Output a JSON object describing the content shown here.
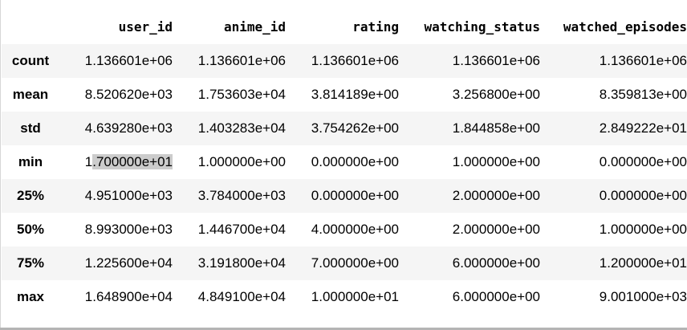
{
  "table": {
    "columns": [
      "user_id",
      "anime_id",
      "rating",
      "watching_status",
      "watched_episodes"
    ],
    "rows": [
      {
        "label": "count",
        "values": [
          "1.136601e+06",
          "1.136601e+06",
          "1.136601e+06",
          "1.136601e+06",
          "1.136601e+06"
        ]
      },
      {
        "label": "mean",
        "values": [
          "8.520620e+03",
          "1.753603e+04",
          "3.814189e+00",
          "3.256800e+00",
          "8.359813e+00"
        ]
      },
      {
        "label": "std",
        "values": [
          "4.639280e+03",
          "1.403283e+04",
          "3.754262e+00",
          "1.844858e+00",
          "2.849222e+01"
        ]
      },
      {
        "label": "min",
        "values": [
          "1.700000e+01",
          "1.000000e+00",
          "0.000000e+00",
          "1.000000e+00",
          "0.000000e+00"
        ]
      },
      {
        "label": "25%",
        "values": [
          "4.951000e+03",
          "3.784000e+03",
          "0.000000e+00",
          "2.000000e+00",
          "0.000000e+00"
        ]
      },
      {
        "label": "50%",
        "values": [
          "8.993000e+03",
          "1.446700e+04",
          "4.000000e+00",
          "2.000000e+00",
          "1.000000e+00"
        ]
      },
      {
        "label": "75%",
        "values": [
          "1.225600e+04",
          "3.191800e+04",
          "7.000000e+00",
          "6.000000e+00",
          "1.200000e+01"
        ]
      },
      {
        "label": "max",
        "values": [
          "1.648900e+04",
          "4.849100e+04",
          "1.000000e+01",
          "6.000000e+00",
          "9.001000e+03"
        ]
      }
    ]
  },
  "selection": {
    "row": 3,
    "col": 0,
    "unselected_prefix": "1",
    "selected_text": ".700000e+01"
  },
  "colors": {
    "stripe": "#f5f5f5",
    "selection": "#cccccc",
    "scrollbar": "#b4b4b4"
  }
}
